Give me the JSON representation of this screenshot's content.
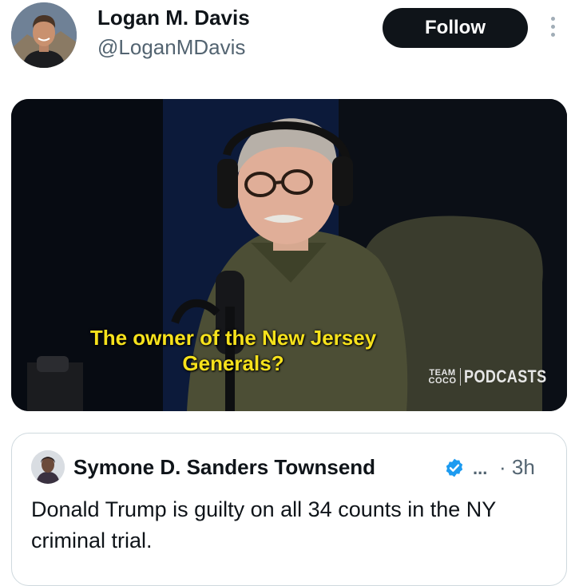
{
  "author": {
    "name": "Logan M. Davis",
    "handle": "@LoganMDavis",
    "avatar_icon": "profile-photo"
  },
  "actions": {
    "follow_label": "Follow",
    "more_icon": "more-vertical-icon"
  },
  "media": {
    "caption_line1": "The owner of the New Jersey",
    "caption_line2": "Generals?",
    "watermark_team": "TEAM",
    "watermark_coco": "COCO",
    "watermark_podcasts": "PODCASTS",
    "caption_color": "#f6e21c"
  },
  "quoted_post": {
    "name": "Symone D. Sanders Townsend",
    "verified": true,
    "ellipsis": "...",
    "time": "· 3h",
    "text": "Donald Trump is guilty on all 34 counts in the NY criminal trial."
  },
  "colors": {
    "text": "#0f1419",
    "secondary": "#536471",
    "verified": "#1d9bf0",
    "follow_bg": "#0f1419"
  }
}
